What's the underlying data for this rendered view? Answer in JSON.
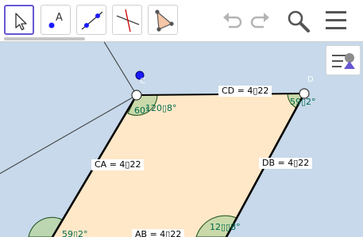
{
  "toolbar": {
    "tools": [
      {
        "id": "move",
        "icon": "cursor-arrow-icon",
        "selected": true
      },
      {
        "id": "point",
        "icon": "point-icon",
        "label": "A",
        "selected": false
      },
      {
        "id": "line",
        "icon": "line-icon",
        "selected": false
      },
      {
        "id": "perpendicular",
        "icon": "perpendicular-line-icon",
        "selected": false
      },
      {
        "id": "polygon",
        "icon": "polygon-icon",
        "selected": false
      }
    ],
    "undo_icon": "undo-icon",
    "redo_icon": "redo-icon",
    "search_icon": "search-icon",
    "menu_icon": "hamburger-menu-icon"
  },
  "style_bar": {
    "icon": "style-bar-toggle-icon"
  },
  "geometry": {
    "points": {
      "C": "C",
      "D": "D"
    },
    "segments": {
      "CD": "CD = 4▯22",
      "CA": "CA = 4▯22",
      "DB": "DB = 4▯22",
      "AB": "AB = 4▯22"
    },
    "angles": {
      "C_top": "120▯8°",
      "C_left": "60°",
      "D": "59▯2°",
      "A": "59▯2°",
      "B": "12▯▯8°"
    }
  },
  "colors": {
    "canvas_bg": "#c7d9ea",
    "polygon_fill": "#ffe8c8",
    "angle_fill": "#b8d49f",
    "accent": "#6557d2",
    "free_point": "#1a1aff"
  }
}
